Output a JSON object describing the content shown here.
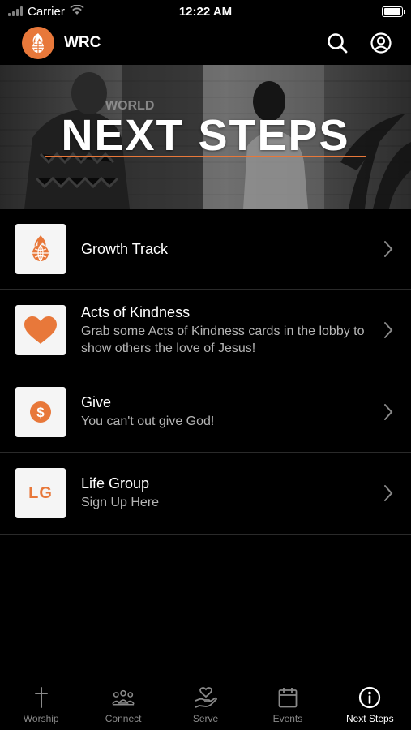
{
  "status_bar": {
    "carrier": "Carrier",
    "time": "12:22 AM"
  },
  "header": {
    "title": "WRC",
    "logo_icon": "flame-globe-icon",
    "search_icon": "search-icon",
    "profile_icon": "user-circle-icon"
  },
  "hero": {
    "title": "NEXT STEPS",
    "accent_color": "#e8783a"
  },
  "list": [
    {
      "title": "Growth Track",
      "subtitle": "",
      "thumb_icon": "flame-globe-icon"
    },
    {
      "title": "Acts of Kindness",
      "subtitle": "Grab some Acts of Kindness cards in the lobby to show others the love of Jesus!",
      "thumb_icon": "heart-icon"
    },
    {
      "title": "Give",
      "subtitle": "You can't out give God!",
      "thumb_icon": "dollar-coin-icon"
    },
    {
      "title": "Life Group",
      "subtitle": "Sign Up Here",
      "thumb_text": "LG"
    }
  ],
  "tabs": [
    {
      "label": "Worship",
      "icon": "cross-icon",
      "active": false
    },
    {
      "label": "Connect",
      "icon": "people-icon",
      "active": false
    },
    {
      "label": "Serve",
      "icon": "hand-heart-icon",
      "active": false
    },
    {
      "label": "Events",
      "icon": "calendar-icon",
      "active": false
    },
    {
      "label": "Next Steps",
      "icon": "info-circle-icon",
      "active": true
    }
  ],
  "colors": {
    "accent": "#e8783a",
    "background": "#000000",
    "tab_inactive": "#8a8a8a"
  }
}
